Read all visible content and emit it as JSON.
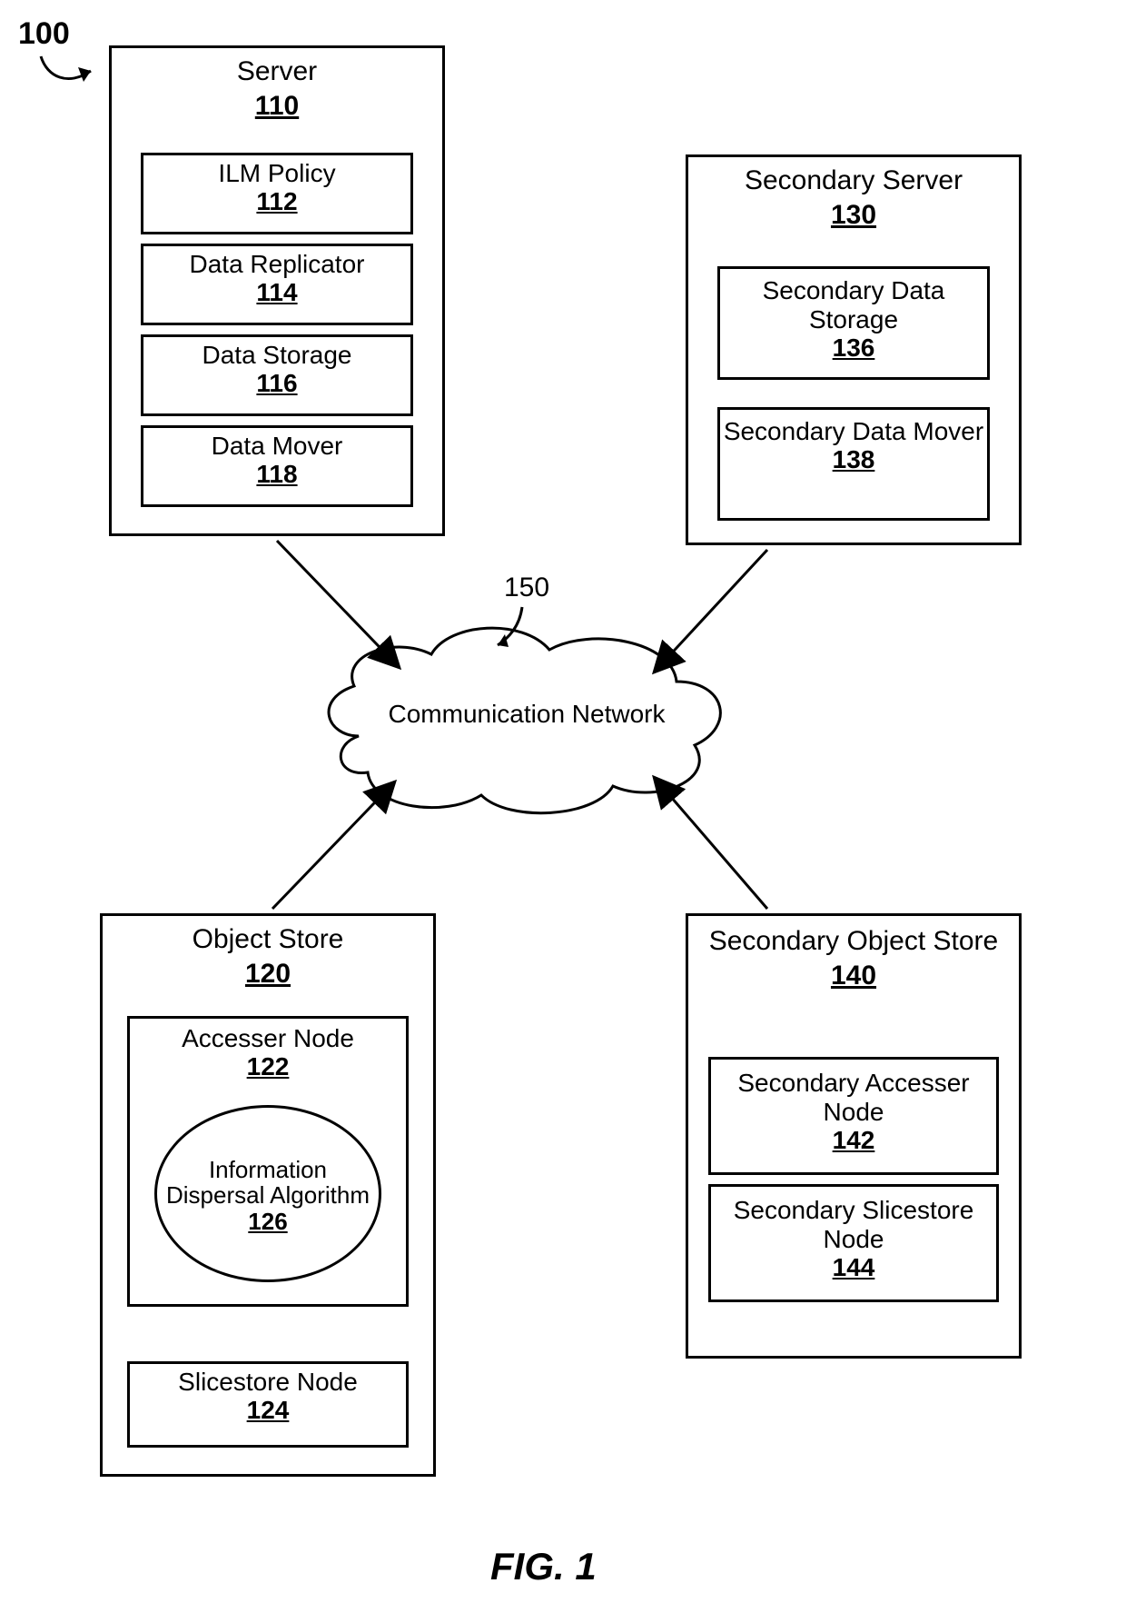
{
  "figure_ref": "100",
  "figure_label": "FIG. 1",
  "cloud": {
    "ref": "150",
    "label": "Communication Network"
  },
  "server": {
    "title": "Server",
    "num": "110",
    "ilm": {
      "label": "ILM Policy",
      "num": "112"
    },
    "replicator": {
      "label": "Data Replicator",
      "num": "114"
    },
    "storage": {
      "label": "Data Storage",
      "num": "116"
    },
    "mover": {
      "label": "Data Mover",
      "num": "118"
    }
  },
  "secondary_server": {
    "title": "Secondary Server",
    "num": "130",
    "storage": {
      "label": "Secondary Data Storage",
      "num": "136"
    },
    "mover": {
      "label": "Secondary Data Mover",
      "num": "138"
    }
  },
  "object_store": {
    "title": "Object Store",
    "num": "120",
    "accesser": {
      "label": "Accesser Node",
      "num": "122"
    },
    "ida": {
      "label": "Information Dispersal Algorithm",
      "num": "126"
    },
    "slicestore": {
      "label": "Slicestore Node",
      "num": "124"
    }
  },
  "secondary_object_store": {
    "title": "Secondary Object Store",
    "num": "140",
    "accesser": {
      "label": "Secondary Accesser Node",
      "num": "142"
    },
    "slicestore": {
      "label": "Secondary Slicestore Node",
      "num": "144"
    }
  }
}
